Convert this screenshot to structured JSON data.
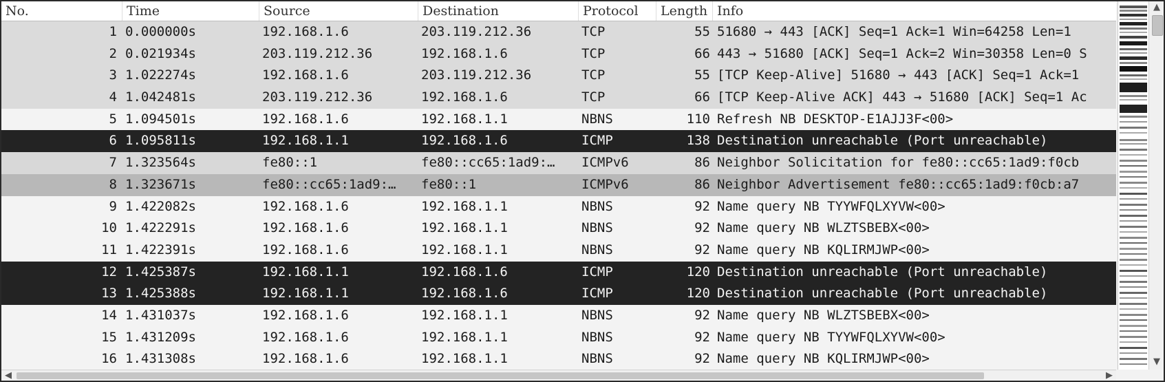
{
  "columns": {
    "no": "No.",
    "time": "Time",
    "source": "Source",
    "destination": "Destination",
    "protocol": "Protocol",
    "length": "Length",
    "info": "Info"
  },
  "packets": [
    {
      "no": "1",
      "time": "0.000000s",
      "source": "192.168.1.6",
      "destination": "203.119.212.36",
      "protocol": "TCP",
      "length": "55",
      "info": "51680 → 443 [ACK] Seq=1 Ack=1 Win=64258 Len=1"
    },
    {
      "no": "2",
      "time": "0.021934s",
      "source": "203.119.212.36",
      "destination": "192.168.1.6",
      "protocol": "TCP",
      "length": "66",
      "info": "443 → 51680 [ACK] Seq=1 Ack=2 Win=30358 Len=0 S"
    },
    {
      "no": "3",
      "time": "1.022274s",
      "source": "192.168.1.6",
      "destination": "203.119.212.36",
      "protocol": "TCP",
      "length": "55",
      "info": "[TCP Keep-Alive] 51680 → 443 [ACK] Seq=1 Ack=1"
    },
    {
      "no": "4",
      "time": "1.042481s",
      "source": "203.119.212.36",
      "destination": "192.168.1.6",
      "protocol": "TCP",
      "length": "66",
      "info": "[TCP Keep-Alive ACK] 443 → 51680 [ACK] Seq=1 Ac"
    },
    {
      "no": "5",
      "time": "1.094501s",
      "source": "192.168.1.6",
      "destination": "192.168.1.1",
      "protocol": "NBNS",
      "length": "110",
      "info": "Refresh NB DESKTOP-E1AJJ3F<00>"
    },
    {
      "no": "6",
      "time": "1.095811s",
      "source": "192.168.1.1",
      "destination": "192.168.1.6",
      "protocol": "ICMP",
      "length": "138",
      "info": "Destination unreachable (Port unreachable)"
    },
    {
      "no": "7",
      "time": "1.323564s",
      "source": "fe80::1",
      "destination": "fe80::cc65:1ad9:…",
      "protocol": "ICMPv6",
      "length": "86",
      "info": "Neighbor Solicitation for fe80::cc65:1ad9:f0cb"
    },
    {
      "no": "8",
      "time": "1.323671s",
      "source": "fe80::cc65:1ad9:…",
      "destination": "fe80::1",
      "protocol": "ICMPv6",
      "length": "86",
      "info": "Neighbor Advertisement fe80::cc65:1ad9:f0cb:a7"
    },
    {
      "no": "9",
      "time": "1.422082s",
      "source": "192.168.1.6",
      "destination": "192.168.1.1",
      "protocol": "NBNS",
      "length": "92",
      "info": "Name query NB TYYWFQLXYVW<00>"
    },
    {
      "no": "10",
      "time": "1.422291s",
      "source": "192.168.1.6",
      "destination": "192.168.1.1",
      "protocol": "NBNS",
      "length": "92",
      "info": "Name query NB WLZTSBEBX<00>"
    },
    {
      "no": "11",
      "time": "1.422391s",
      "source": "192.168.1.6",
      "destination": "192.168.1.1",
      "protocol": "NBNS",
      "length": "92",
      "info": "Name query NB KQLIRMJWP<00>"
    },
    {
      "no": "12",
      "time": "1.425387s",
      "source": "192.168.1.1",
      "destination": "192.168.1.6",
      "protocol": "ICMP",
      "length": "120",
      "info": "Destination unreachable (Port unreachable)"
    },
    {
      "no": "13",
      "time": "1.425388s",
      "source": "192.168.1.1",
      "destination": "192.168.1.6",
      "protocol": "ICMP",
      "length": "120",
      "info": "Destination unreachable (Port unreachable)"
    },
    {
      "no": "14",
      "time": "1.431037s",
      "source": "192.168.1.6",
      "destination": "192.168.1.1",
      "protocol": "NBNS",
      "length": "92",
      "info": "Name query NB WLZTSBEBX<00>"
    },
    {
      "no": "15",
      "time": "1.431209s",
      "source": "192.168.1.6",
      "destination": "192.168.1.1",
      "protocol": "NBNS",
      "length": "92",
      "info": "Name query NB TYYWFQLXYVW<00>"
    },
    {
      "no": "16",
      "time": "1.431308s",
      "source": "192.168.1.6",
      "destination": "192.168.1.1",
      "protocol": "NBNS",
      "length": "92",
      "info": "Name query NB KQLIRMJWP<00>"
    }
  ],
  "scrollbars": {
    "up_icon": "chevron-up-icon",
    "down_icon": "chevron-down-icon",
    "left_icon": "chevron-left-icon",
    "right_icon": "chevron-right-icon"
  }
}
